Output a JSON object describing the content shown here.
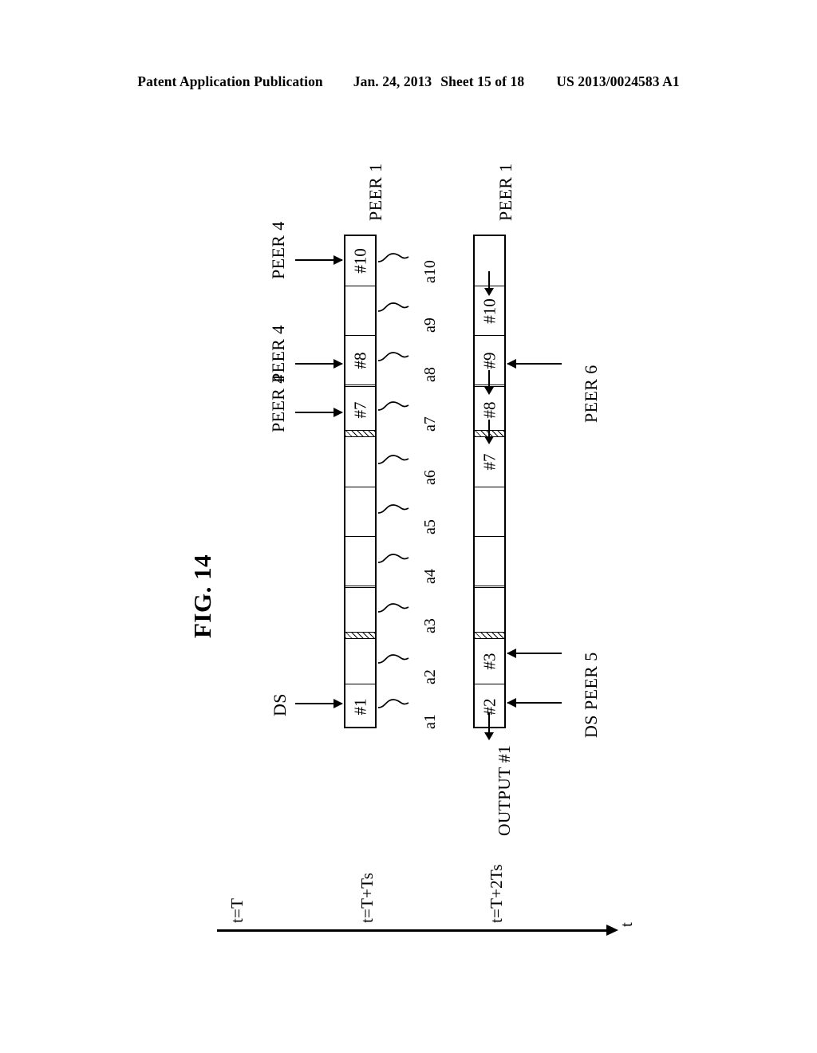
{
  "header": {
    "publication": "Patent Application Publication",
    "date": "Jan. 24, 2013",
    "sheet": "Sheet 15 of 18",
    "docnum": "US 2013/0024583 A1"
  },
  "figure": {
    "label": "FIG. 14",
    "time_axis": {
      "axis_label": "t",
      "ticks": [
        "t=T",
        "t=T+Ts",
        "t=T+2Ts"
      ]
    },
    "rows": [
      {
        "id": "row-upper",
        "time": "t=T+Ts",
        "peer_label": "PEER 1",
        "cells": [
          {
            "label": "#1",
            "index": 1
          },
          {
            "label": "",
            "index": 2
          },
          {
            "label": "",
            "index": 3
          },
          {
            "label": "",
            "index": 4
          },
          {
            "label": "",
            "index": 5
          },
          {
            "label": "",
            "index": 6
          },
          {
            "label": "#7",
            "index": 7
          },
          {
            "label": "#8",
            "index": 8
          },
          {
            "label": "",
            "index": 9
          },
          {
            "label": "#10",
            "index": 10
          }
        ],
        "leaders": [
          "a1",
          "a2",
          "a3",
          "a4",
          "a5",
          "a6",
          "a7",
          "a8",
          "a9",
          "a10"
        ],
        "incoming": [
          {
            "source": "DS",
            "target": "#1"
          },
          {
            "source": "PEER 4",
            "target": "#7"
          },
          {
            "source": "PEER 4",
            "target": "#8"
          },
          {
            "source": "PEER 4",
            "target": "#10"
          }
        ]
      },
      {
        "id": "row-lower",
        "time": "t=T+2Ts",
        "peer_label": "PEER 1",
        "cells": [
          {
            "label": "#2",
            "index": 1
          },
          {
            "label": "#3",
            "index": 2
          },
          {
            "label": "",
            "index": 3
          },
          {
            "label": "",
            "index": 4
          },
          {
            "label": "",
            "index": 5
          },
          {
            "label": "#7",
            "index": 6
          },
          {
            "label": "#8",
            "index": 7
          },
          {
            "label": "#9",
            "index": 8
          },
          {
            "label": "#10",
            "index": 9
          },
          {
            "label": "",
            "index": 10
          }
        ],
        "output": "OUTPUT #1",
        "incoming": [
          {
            "source": "DS",
            "target": "#2"
          },
          {
            "source": "PEER 5",
            "target": "#3"
          },
          {
            "source": "PEER 6",
            "target": "#9"
          }
        ]
      }
    ]
  }
}
